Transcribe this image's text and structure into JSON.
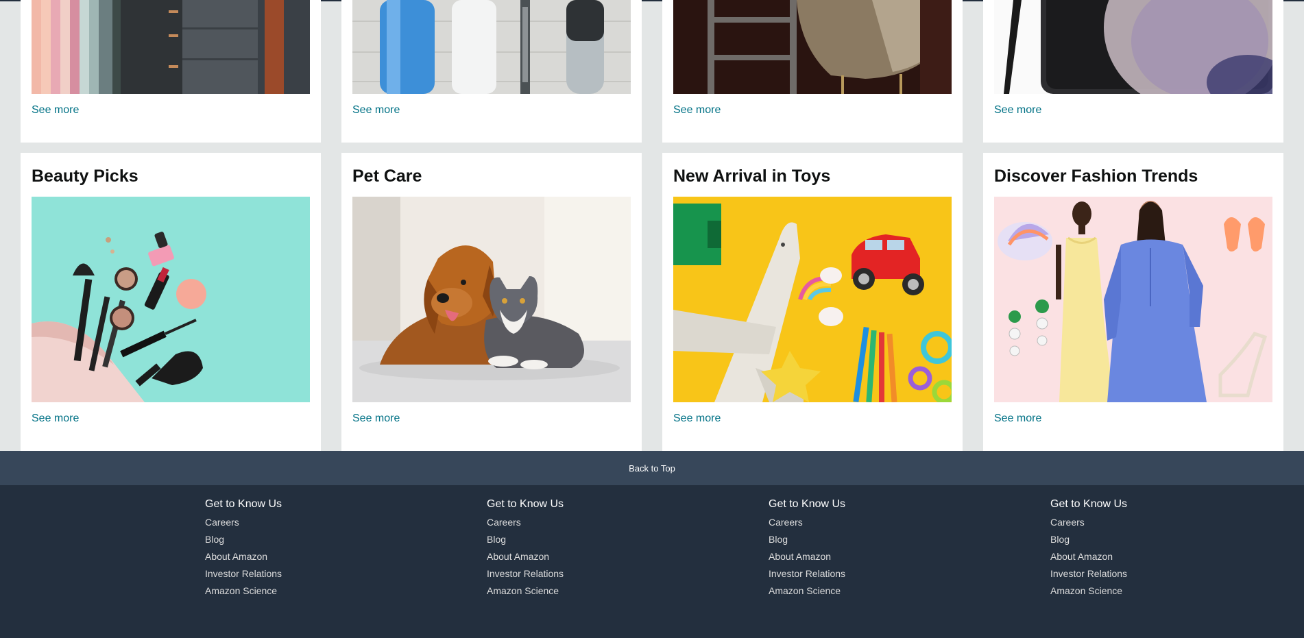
{
  "cards_top": [
    {
      "see_more": "See more"
    },
    {
      "see_more": "See more"
    },
    {
      "see_more": "See more"
    },
    {
      "see_more": "See more"
    }
  ],
  "cards": [
    {
      "title": "Beauty Picks",
      "see_more": "See more"
    },
    {
      "title": "Pet Care",
      "see_more": "See more"
    },
    {
      "title": "New Arrival in Toys",
      "see_more": "See more"
    },
    {
      "title": "Discover Fashion Trends",
      "see_more": "See more"
    }
  ],
  "back_to_top": "Back to Top",
  "footer": {
    "columns": [
      {
        "heading": "Get to Know Us",
        "links": [
          "Careers",
          "Blog",
          "About Amazon",
          "Investor Relations",
          "Amazon Science"
        ]
      },
      {
        "heading": "Get to Know Us",
        "links": [
          "Careers",
          "Blog",
          "About Amazon",
          "Investor Relations",
          "Amazon Science"
        ]
      },
      {
        "heading": "Get to Know Us",
        "links": [
          "Careers",
          "Blog",
          "About Amazon",
          "Investor Relations",
          "Amazon Science"
        ]
      },
      {
        "heading": "Get to Know Us",
        "links": [
          "Careers",
          "Blog",
          "About Amazon",
          "Investor Relations",
          "Amazon Science"
        ]
      }
    ]
  },
  "colors": {
    "page_bg": "#e3e6e6",
    "link": "#007185",
    "back_to_top_bg": "#37475a",
    "footer_bg": "#232f3e"
  }
}
